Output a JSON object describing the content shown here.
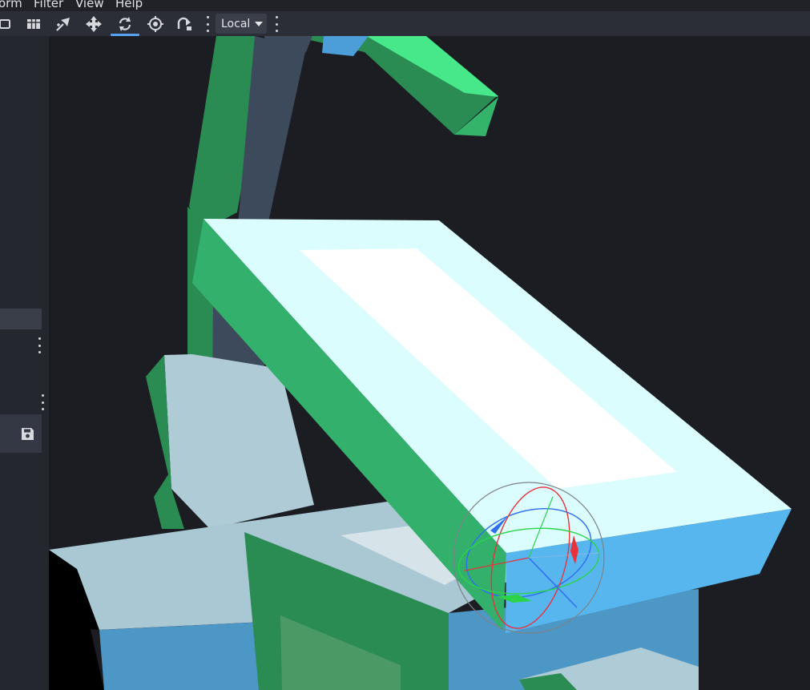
{
  "menubar": {
    "items": [
      {
        "label": "orm"
      },
      {
        "label": "Filter"
      },
      {
        "label": "View"
      },
      {
        "label": "Help"
      }
    ]
  },
  "toolbar": {
    "tools": [
      {
        "icon": "layout-icon"
      },
      {
        "icon": "grid-icon"
      },
      {
        "icon": "select-tool-icon"
      },
      {
        "icon": "move-tool-icon"
      },
      {
        "icon": "rotate-tool-icon",
        "active": true
      },
      {
        "icon": "pivot-target-icon"
      },
      {
        "icon": "snap-arrow-icon"
      }
    ],
    "space_dropdown": {
      "label": "Local"
    },
    "accent_color": "#5aa0f0"
  },
  "side_panel": {
    "save_icon": "save-icon"
  },
  "viewport": {
    "background": "#1b1d22",
    "gizmo": {
      "type": "rotate",
      "axis_colors": {
        "x": "#e8323c",
        "y": "#2bd34a",
        "z": "#2f6ff0"
      }
    }
  }
}
